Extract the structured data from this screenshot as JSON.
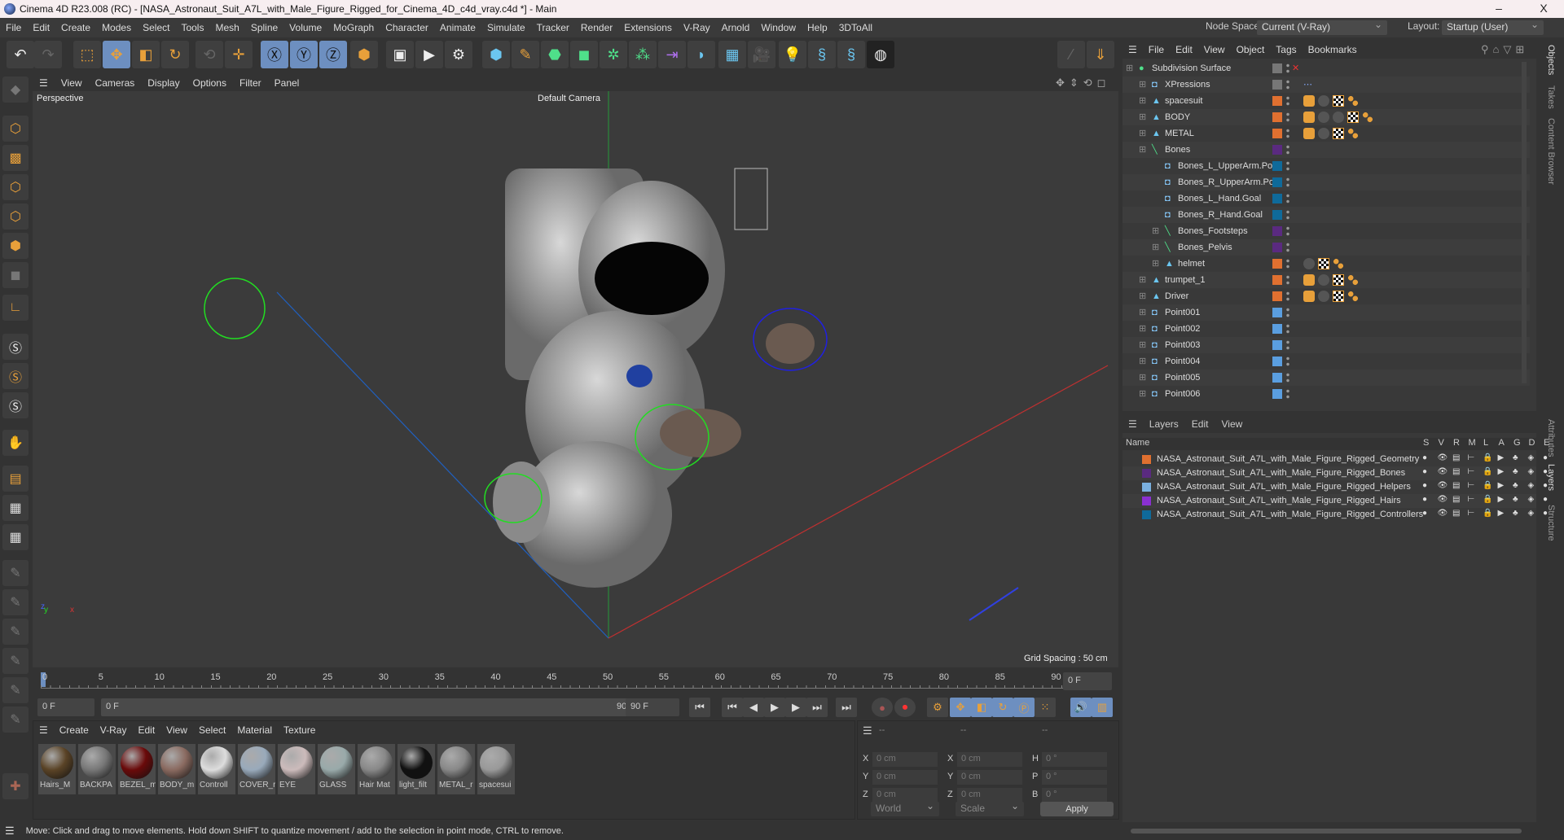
{
  "window": {
    "title": "Cinema 4D R23.008 (RC) - [NASA_Astronaut_Suit_A7L_with_Male_Figure_Rigged_for_Cinema_4D_c4d_vray.c4d *] - Main",
    "minimize": "–",
    "maximize": "▢",
    "close": "X"
  },
  "menu": [
    "File",
    "Edit",
    "Create",
    "Modes",
    "Select",
    "Tools",
    "Mesh",
    "Spline",
    "Volume",
    "MoGraph",
    "Character",
    "Animate",
    "Simulate",
    "Tracker",
    "Render",
    "Extensions",
    "V-Ray",
    "Arnold",
    "Window",
    "Help",
    "3DToAll"
  ],
  "nodespace": {
    "label": "Node Space:",
    "value": "Current (V-Ray)"
  },
  "layout": {
    "label": "Layout:",
    "value": "Startup (User)"
  },
  "viewport": {
    "menu": [
      "View",
      "Cameras",
      "Display",
      "Options",
      "Filter",
      "Panel"
    ],
    "name": "Perspective",
    "camera": "Default Camera",
    "grid_spacing": "Grid Spacing : 50 cm"
  },
  "timeline": {
    "ticks": [
      "0",
      "5",
      "10",
      "15",
      "20",
      "25",
      "30",
      "35",
      "40",
      "45",
      "50",
      "55",
      "60",
      "65",
      "70",
      "75",
      "80",
      "85",
      "90"
    ],
    "current_frame": "0 F",
    "start": "0 F",
    "range_start": "0 F",
    "range_end": "90 F",
    "end": "90 F"
  },
  "materials": {
    "menu": [
      "Create",
      "V-Ray",
      "Edit",
      "View",
      "Select",
      "Material",
      "Texture"
    ],
    "items": [
      {
        "name": "Hairs_M",
        "color": "#5a4326"
      },
      {
        "name": "BACKPA",
        "color": "#777"
      },
      {
        "name": "BEZEL_m",
        "color": "#6a0a0a"
      },
      {
        "name": "BODY_m",
        "color": "#8a6a60"
      },
      {
        "name": "Controll",
        "color": "#ddd"
      },
      {
        "name": "COVER_r",
        "color": "#9ab"
      },
      {
        "name": "EYE",
        "color": "#cbb"
      },
      {
        "name": "GLASS",
        "color": "#9aa"
      },
      {
        "name": "Hair Mat",
        "color": "#888"
      },
      {
        "name": "light_filt",
        "color": "#111"
      },
      {
        "name": "METAL_r",
        "color": "#888"
      },
      {
        "name": "spacesui",
        "color": "#999"
      }
    ]
  },
  "coords": {
    "header": [
      "--",
      "--",
      "--"
    ],
    "rows": [
      {
        "a": "X",
        "av": "0 cm",
        "b": "X",
        "bv": "0 cm",
        "c": "H",
        "cv": "0 °"
      },
      {
        "a": "Y",
        "av": "0 cm",
        "b": "Y",
        "bv": "0 cm",
        "c": "P",
        "cv": "0 °"
      },
      {
        "a": "Z",
        "av": "0 cm",
        "b": "Z",
        "bv": "0 cm",
        "c": "B",
        "cv": "0 °"
      }
    ],
    "space": "World",
    "mode": "Scale",
    "apply": "Apply"
  },
  "status": "Move: Click and drag to move elements. Hold down SHIFT to quantize movement / add to the selection in point mode, CTRL to remove.",
  "objects": {
    "menu": [
      "File",
      "Edit",
      "View",
      "Object",
      "Tags",
      "Bookmarks"
    ],
    "items": [
      {
        "name": "Subdivision Surface",
        "depth": 0,
        "icon": "●",
        "iconColor": "#4fe08a",
        "swatch": "#777",
        "tags": []
      },
      {
        "name": "XPressions",
        "depth": 1,
        "icon": "◘",
        "iconColor": "#8cf",
        "swatch": "#777",
        "tags": [
          "xp"
        ]
      },
      {
        "name": "spacesuit",
        "depth": 1,
        "icon": "▲",
        "iconColor": "#6bc6f0",
        "swatch": "#e07030",
        "tags": [
          "ph",
          "ball",
          "chk",
          "dot"
        ]
      },
      {
        "name": "BODY",
        "depth": 1,
        "icon": "▲",
        "iconColor": "#6bc6f0",
        "swatch": "#e07030",
        "tags": [
          "ph",
          "ball",
          "ball",
          "chk",
          "dot"
        ]
      },
      {
        "name": "METAL",
        "depth": 1,
        "icon": "▲",
        "iconColor": "#6bc6f0",
        "swatch": "#e07030",
        "tags": [
          "ph",
          "ball",
          "chk",
          "dot"
        ]
      },
      {
        "name": "Bones",
        "depth": 1,
        "icon": "╲",
        "iconColor": "#4fe08a",
        "swatch": "#5a2a80",
        "tags": []
      },
      {
        "name": "Bones_L_UpperArm.Pole",
        "depth": 2,
        "icon": "◘",
        "iconColor": "#8cf",
        "swatch": "#0f6a9a",
        "tags": []
      },
      {
        "name": "Bones_R_UpperArm.Pole",
        "depth": 2,
        "icon": "◘",
        "iconColor": "#8cf",
        "swatch": "#0f6a9a",
        "tags": []
      },
      {
        "name": "Bones_L_Hand.Goal",
        "depth": 2,
        "icon": "◘",
        "iconColor": "#8cf",
        "swatch": "#0f6a9a",
        "tags": []
      },
      {
        "name": "Bones_R_Hand.Goal",
        "depth": 2,
        "icon": "◘",
        "iconColor": "#8cf",
        "swatch": "#0f6a9a",
        "tags": []
      },
      {
        "name": "Bones_Footsteps",
        "depth": 2,
        "icon": "╲",
        "iconColor": "#4fe08a",
        "swatch": "#5a2a80",
        "tags": []
      },
      {
        "name": "Bones_Pelvis",
        "depth": 2,
        "icon": "╲",
        "iconColor": "#4fe08a",
        "swatch": "#5a2a80",
        "tags": []
      },
      {
        "name": "helmet",
        "depth": 2,
        "icon": "▲",
        "iconColor": "#6bc6f0",
        "swatch": "#e07030",
        "tags": [
          "ball",
          "chk",
          "dot"
        ]
      },
      {
        "name": "trumpet_1",
        "depth": 1,
        "icon": "▲",
        "iconColor": "#6bc6f0",
        "swatch": "#e07030",
        "tags": [
          "ph",
          "ball",
          "chk",
          "dot"
        ]
      },
      {
        "name": "Driver",
        "depth": 1,
        "icon": "▲",
        "iconColor": "#6bc6f0",
        "swatch": "#e07030",
        "tags": [
          "ph",
          "ball",
          "chk",
          "dot"
        ]
      },
      {
        "name": "Point001",
        "depth": 1,
        "icon": "◘",
        "iconColor": "#8cf",
        "swatch": "#5a9ee0",
        "tags": []
      },
      {
        "name": "Point002",
        "depth": 1,
        "icon": "◘",
        "iconColor": "#8cf",
        "swatch": "#5a9ee0",
        "tags": []
      },
      {
        "name": "Point003",
        "depth": 1,
        "icon": "◘",
        "iconColor": "#8cf",
        "swatch": "#5a9ee0",
        "tags": []
      },
      {
        "name": "Point004",
        "depth": 1,
        "icon": "◘",
        "iconColor": "#8cf",
        "swatch": "#5a9ee0",
        "tags": []
      },
      {
        "name": "Point005",
        "depth": 1,
        "icon": "◘",
        "iconColor": "#8cf",
        "swatch": "#5a9ee0",
        "tags": []
      },
      {
        "name": "Point006",
        "depth": 1,
        "icon": "◘",
        "iconColor": "#8cf",
        "swatch": "#5a9ee0",
        "tags": []
      }
    ]
  },
  "layers": {
    "menu": [
      "Layers",
      "Edit",
      "View"
    ],
    "name_header": "Name",
    "cols": [
      "S",
      "V",
      "R",
      "M",
      "L",
      "A",
      "G",
      "D",
      "E"
    ],
    "items": [
      {
        "name": "NASA_Astronaut_Suit_A7L_with_Male_Figure_Rigged_Geometry",
        "color": "#e07030"
      },
      {
        "name": "NASA_Astronaut_Suit_A7L_with_Male_Figure_Rigged_Bones",
        "color": "#5a2a80"
      },
      {
        "name": "NASA_Astronaut_Suit_A7L_with_Male_Figure_Rigged_Helpers",
        "color": "#7ab0e0"
      },
      {
        "name": "NASA_Astronaut_Suit_A7L_with_Male_Figure_Rigged_Hairs",
        "color": "#8a30d0"
      },
      {
        "name": "NASA_Astronaut_Suit_A7L_with_Male_Figure_Rigged_Controllers",
        "color": "#0f6a9a"
      }
    ]
  },
  "side_tabs": [
    "Objects",
    "Takes",
    "Content Browser",
    "Attributes",
    "Layers",
    "Structure"
  ]
}
